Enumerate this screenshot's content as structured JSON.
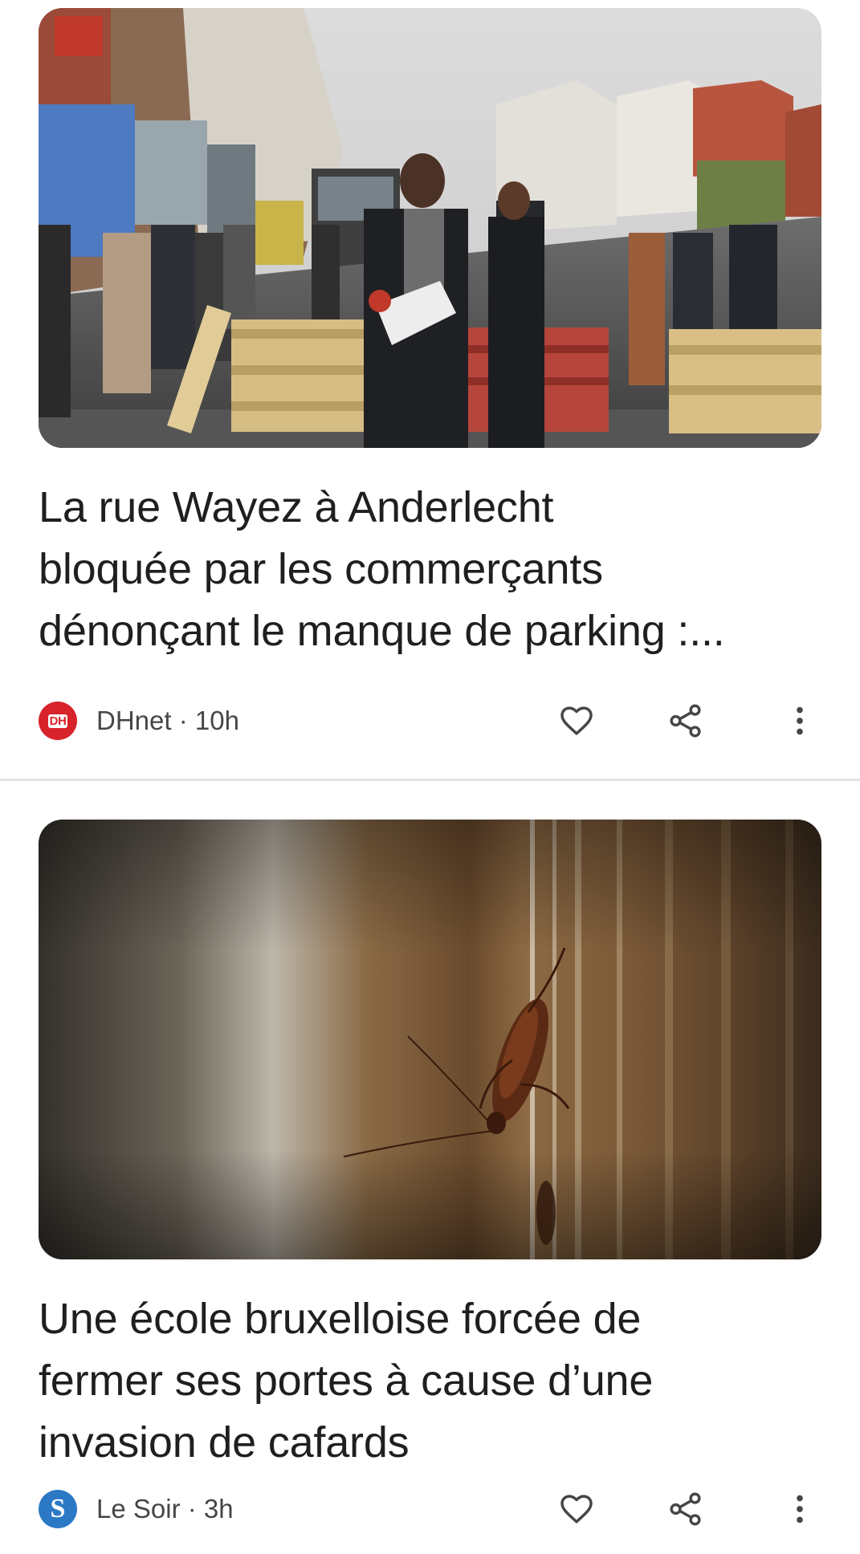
{
  "articles": [
    {
      "headline_lines": [
        "La rue Wayez à Anderlecht",
        "bloquée par les commerçants",
        "dénonçant le manque de parking :..."
      ],
      "source": {
        "logo_text": "DH",
        "logo_letters": [
          "D",
          "H"
        ],
        "name": "DHnet",
        "age": "10h",
        "meta_line": "DHnet · 10h",
        "logo_color": "#d8232a"
      },
      "image_subject": "street-protest-photo",
      "actions": [
        "like",
        "share",
        "more"
      ]
    },
    {
      "headline_lines": [
        "Une école bruxelloise forcée de",
        "fermer ses portes à cause d’une",
        "invasion de cafards"
      ],
      "source": {
        "logo_text": "S",
        "name": "Le Soir",
        "age": "3h",
        "meta_line": "Le Soir · 3h",
        "logo_color": "#2b78c5"
      },
      "image_subject": "cockroach-photo",
      "actions": [
        "like",
        "share",
        "more"
      ]
    }
  ],
  "icons": {
    "like": "heart-outline-icon",
    "share": "share-icon",
    "more": "more-vert-icon"
  },
  "colors": {
    "headline": "#1f1f1f",
    "meta": "#444746",
    "icon": "#444746",
    "divider": "#e3e3e3",
    "background": "#ffffff"
  }
}
